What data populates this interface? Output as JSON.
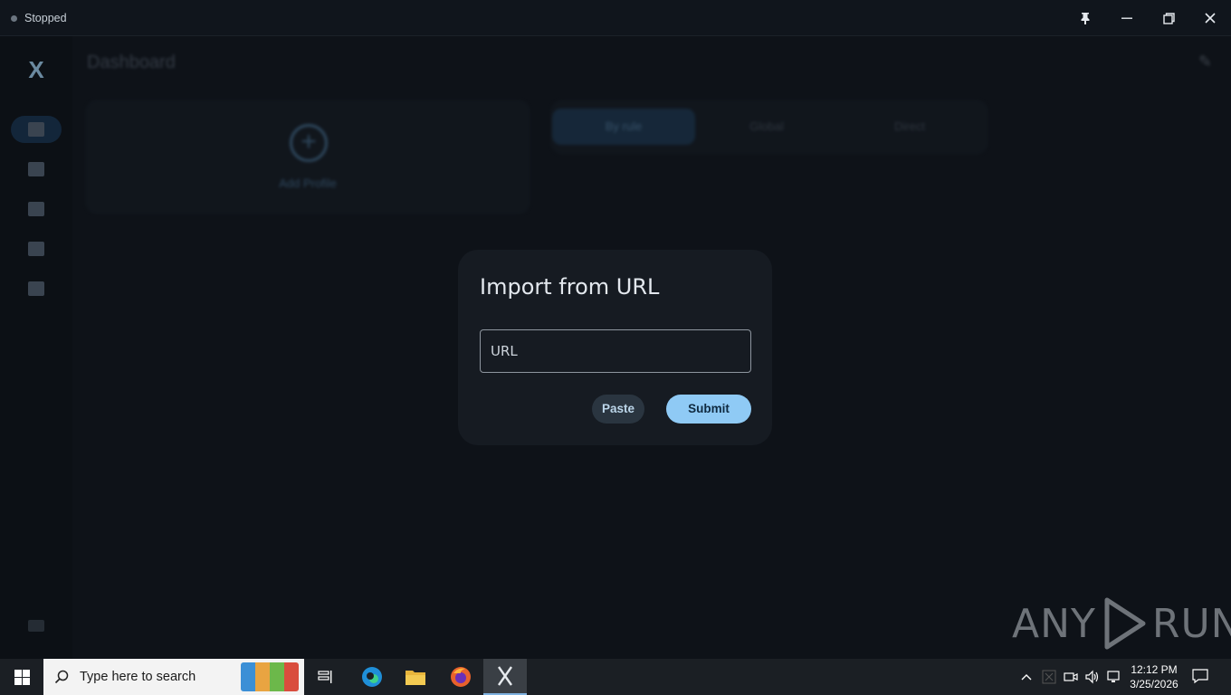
{
  "titlebar": {
    "status": "Stopped",
    "pin_icon": "pin-icon",
    "minimize_icon": "minimize-icon",
    "maximize_icon": "maximize-icon",
    "close_icon": "close-icon"
  },
  "sidebar": {
    "logo": "X",
    "items": [
      {
        "name": "dashboard",
        "active": true
      },
      {
        "name": "profiles",
        "active": false
      },
      {
        "name": "logs",
        "active": false
      },
      {
        "name": "proxies",
        "active": false
      },
      {
        "name": "settings",
        "active": false
      }
    ]
  },
  "main": {
    "title": "Dashboard",
    "add_profile_label": "Add Profile",
    "modes": [
      "By rule",
      "Global",
      "Direct"
    ],
    "active_mode": "By rule"
  },
  "dialog": {
    "title": "Import from URL",
    "url_placeholder": "URL",
    "url_value": "",
    "paste_label": "Paste",
    "submit_label": "Submit"
  },
  "watermark": {
    "left": "ANY",
    "right": "RUN"
  },
  "taskbar": {
    "search_placeholder": "Type here to search",
    "time": "12:12 PM",
    "date": "3/25/2026"
  },
  "colors": {
    "accent": "#8fcaf5",
    "dialog_bg": "#161b22",
    "app_bg": "#0e1218"
  }
}
